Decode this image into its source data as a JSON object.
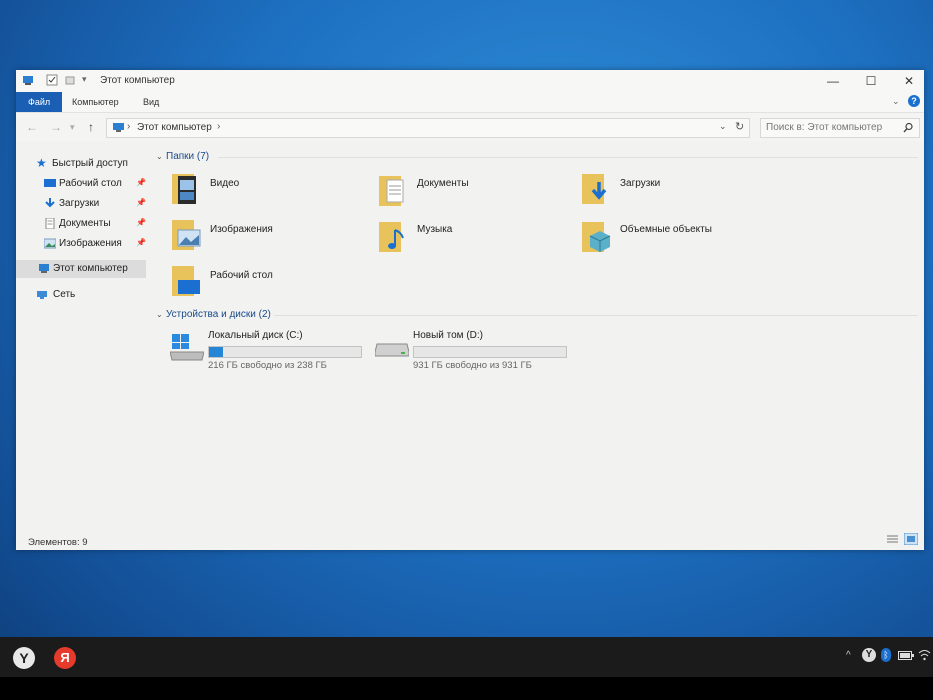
{
  "window": {
    "title": "Этот компьютер",
    "ribbon_tabs": [
      "Файл",
      "Компьютер",
      "Вид"
    ],
    "address": "Этот компьютер",
    "search_placeholder": "Поиск в: Этот компьютер",
    "status": "Элементов: 9"
  },
  "sidebar": {
    "quick_access": "Быстрый доступ",
    "items": [
      {
        "label": "Рабочий стол",
        "icon": "desktop-icon"
      },
      {
        "label": "Загрузки",
        "icon": "downloads-icon"
      },
      {
        "label": "Документы",
        "icon": "documents-icon"
      },
      {
        "label": "Изображения",
        "icon": "pictures-icon"
      }
    ],
    "this_pc": "Этот компьютер",
    "network": "Сеть"
  },
  "groups": {
    "folders_header": "Папки (7)",
    "devices_header": "Устройства и диски (2)"
  },
  "folders": [
    {
      "name": "Видео",
      "icon": "video-folder-icon"
    },
    {
      "name": "Документы",
      "icon": "documents-folder-icon"
    },
    {
      "name": "Загрузки",
      "icon": "downloads-folder-icon"
    },
    {
      "name": "Изображения",
      "icon": "pictures-folder-icon"
    },
    {
      "name": "Музыка",
      "icon": "music-folder-icon"
    },
    {
      "name": "Объемные объекты",
      "icon": "3d-objects-folder-icon"
    },
    {
      "name": "Рабочий стол",
      "icon": "desktop-folder-icon"
    }
  ],
  "drives": [
    {
      "name": "Локальный диск (C:)",
      "free": "216 ГБ свободно из 238 ГБ",
      "used_fraction": 0.09
    },
    {
      "name": "Новый том (D:)",
      "free": "931 ГБ свободно из 931 ГБ",
      "used_fraction": 0.0
    }
  ],
  "colors": {
    "accent": "#1a5fb4",
    "drive_bar": "#2686d6",
    "folder": "#e8c25a"
  }
}
